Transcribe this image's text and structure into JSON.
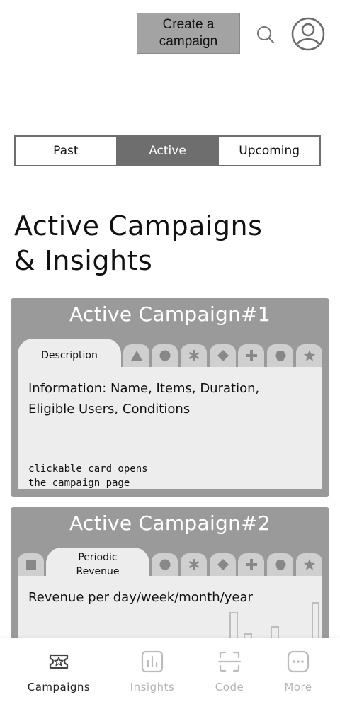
{
  "header": {
    "create_button_label": "Create a campaign",
    "search_icon": "search-icon",
    "avatar_icon": "user-circle-icon"
  },
  "segments": [
    {
      "label": "Past",
      "active": false
    },
    {
      "label": "Active",
      "active": true
    },
    {
      "label": "Upcoming",
      "active": false
    }
  ],
  "page_title_line1": "Active Campaigns",
  "page_title_line2": "& Insights",
  "cards": [
    {
      "title": "Active Campaign#1",
      "active_tab": "Description",
      "tab_icons": [
        "triangle-icon",
        "circle-icon",
        "star-burst-icon",
        "diamond-icon",
        "plus-icon",
        "hexagon-icon",
        "star-icon"
      ],
      "info_line1": "Information: Name, Items, Duration,",
      "info_line2": "Eligible Users, Conditions",
      "note_line1": "clickable card opens",
      "note_line2": "the campaign page"
    },
    {
      "title": "Active Campaign#2",
      "active_tab_line1": "Periodic",
      "active_tab_line2": "Revenue",
      "tab_icons": [
        "square-icon",
        "circle-icon",
        "star-burst-icon",
        "diamond-icon",
        "plus-icon",
        "hexagon-icon",
        "star-icon"
      ],
      "info_line1": "Revenue per day/week/month/year"
    }
  ],
  "bottom_nav": [
    {
      "label": "Campaigns",
      "icon": "campaign-ticket-icon",
      "active": true
    },
    {
      "label": "Insights",
      "icon": "bar-chart-icon",
      "active": false
    },
    {
      "label": "Code",
      "icon": "scan-code-icon",
      "active": false
    },
    {
      "label": "More",
      "icon": "more-dots-icon",
      "active": false
    }
  ],
  "colors": {
    "active_segment": "#6e6e6e",
    "card_background": "#9a9a9a",
    "card_body": "#ededed",
    "inactive_nav": "#b4b4b4"
  }
}
